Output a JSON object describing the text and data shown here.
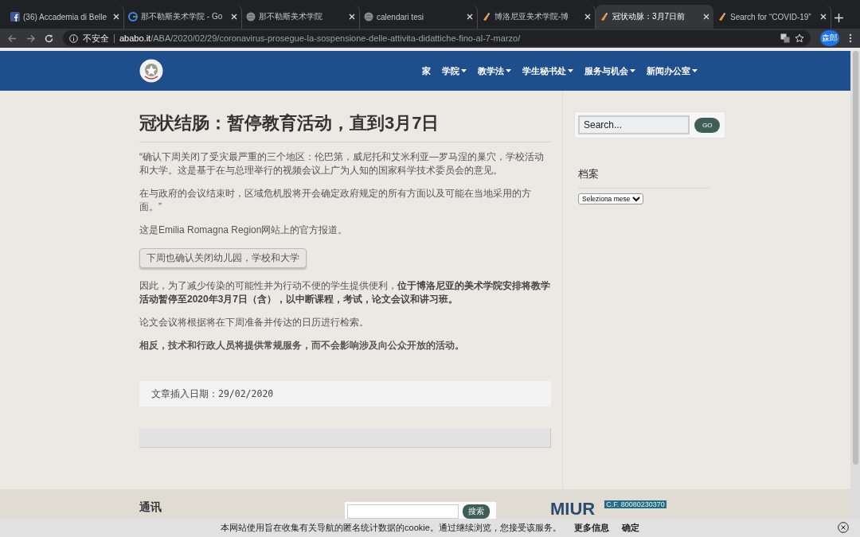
{
  "browser": {
    "tabs": [
      {
        "title": "(36) Accademia di Belle",
        "kind": "facebook",
        "selected": false
      },
      {
        "title": "那不勒斯美术学院 - Go",
        "kind": "google",
        "selected": false
      },
      {
        "title": "那不勒斯美术学院",
        "kind": "globe",
        "selected": false
      },
      {
        "title": "calendari tesi",
        "kind": "globe",
        "selected": false
      },
      {
        "title": "博洛尼亚美术学院-博",
        "kind": "brush",
        "selected": false
      },
      {
        "title": "冠状动脉：3月7日前",
        "kind": "brush",
        "selected": true
      },
      {
        "title": "Search for “COVID-19”",
        "kind": "brush",
        "selected": false
      }
    ],
    "security_label": "不安全",
    "url_host": "ababo.it",
    "url_path": "/ABA/2020/02/29/coronavirus-prosegue-la-sospensione-delle-attivita-didattiche-fino-al-7-marzo/",
    "profile": "森郎"
  },
  "nav": [
    {
      "label": "家",
      "has_menu": false
    },
    {
      "label": "学院",
      "has_menu": true
    },
    {
      "label": "教学法",
      "has_menu": true
    },
    {
      "label": "学生秘书处",
      "has_menu": true
    },
    {
      "label": "服务与机会",
      "has_menu": true
    },
    {
      "label": "新闻办公室",
      "has_menu": true
    }
  ],
  "article": {
    "title": "冠状结肠：暂停教育活动，直到3月7日",
    "blocks": [
      {
        "kind": "paragraph",
        "text": "“确认下周关闭了受灾最严重的三个地区：伦巴第，威尼托和艾米利亚—罗马涅的巢穴，学校活动和大学。这是基于在与总理举行的视频会议上广为人知的国家科学技术委员会的意见。"
      },
      {
        "kind": "paragraph",
        "text": "在与政府的会议结束时，区域危机股将开会确定政府规定的所有方面以及可能在当地采用的方面。”"
      },
      {
        "kind": "paragraph",
        "text": "这是Emilia Romagna Region网站上的官方报道。"
      },
      {
        "kind": "button",
        "text": "下周也确认关闭幼儿园，学校和大学"
      },
      {
        "kind": "paragraph",
        "text": "因此，为了减少传染的可能性并为行动不便的学生提供便利，**位于博洛尼亚的美术学院安排将教学活动暂停至2020年3月7日（含），以中断课程，考试，论文会议和讲习班。**"
      },
      {
        "kind": "paragraph",
        "text": "论文会议将根据将在下周准备并传达的日历进行检索。"
      },
      {
        "kind": "bold",
        "text": "相反，技术和行政人员将提供常规服务，而不会影响涉及向公众开放的活动。"
      }
    ],
    "date_note": "文章插入日期：29/02/2020"
  },
  "sidebar": {
    "search_placeholder": "Search...",
    "search_button": "GO",
    "archive_title": "档案",
    "archive_select": "Seleziona mese"
  },
  "footer": {
    "heading": "通讯",
    "search_button": "搜索",
    "logo_text": "MIUR",
    "fiscal_code": "C.F. 80080230370"
  },
  "cookie_bar": {
    "text": "本网站使用旨在收集有关导航的匿名统计数据的cookie。通过继续浏览，您接受该服务。",
    "more": "更多信息",
    "ok": "确定"
  }
}
